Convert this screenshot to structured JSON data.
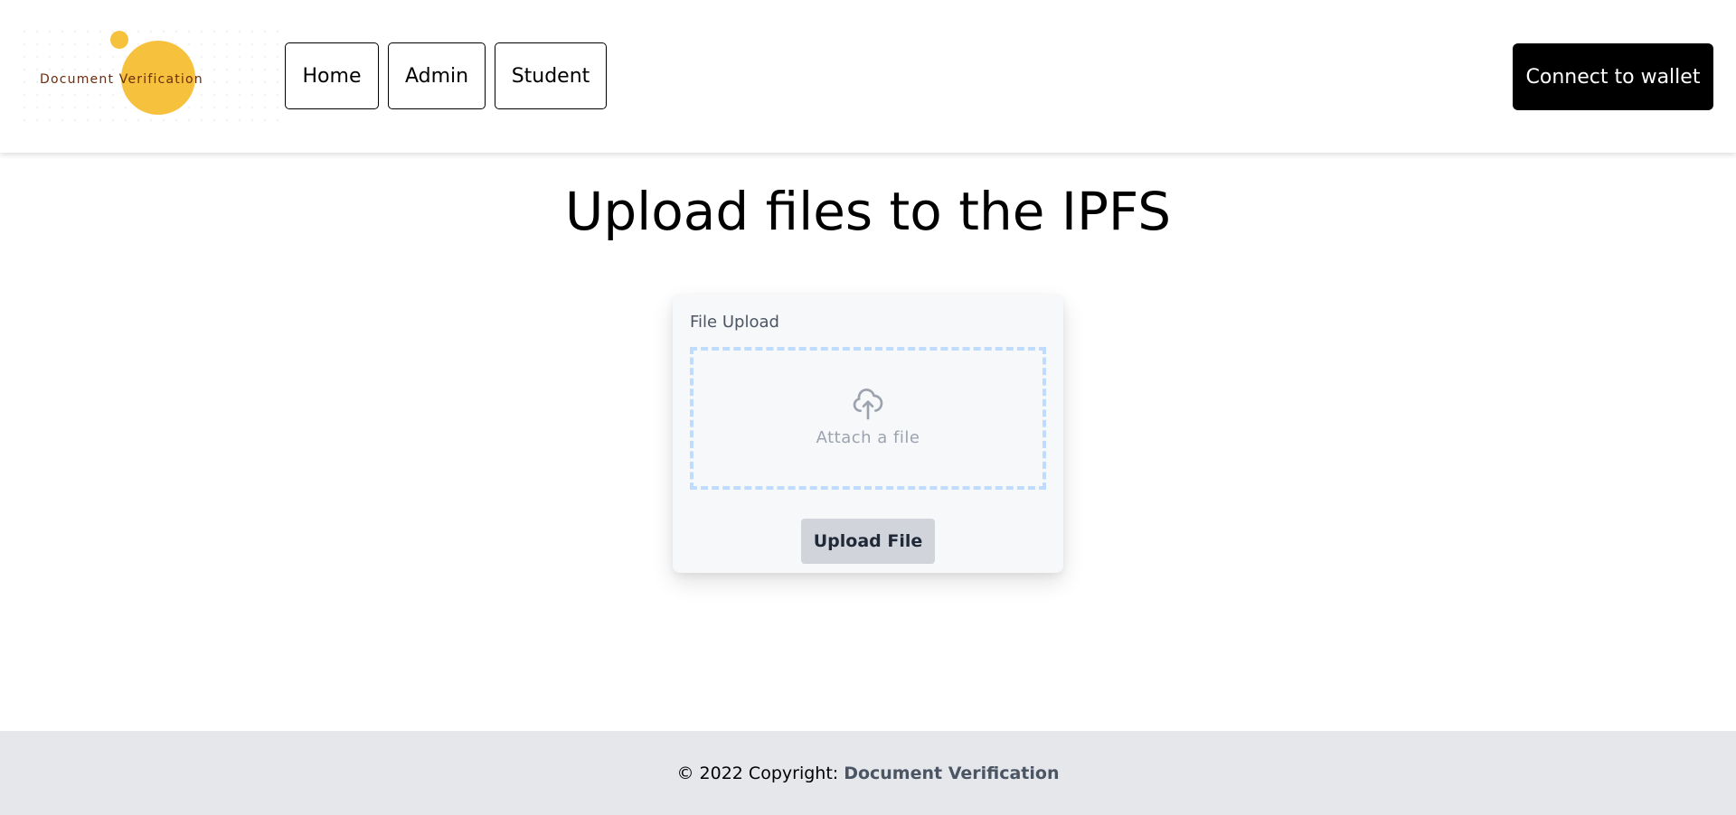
{
  "header": {
    "logo_text": "Document Verification",
    "nav": {
      "home": "Home",
      "admin": "Admin",
      "student": "Student"
    },
    "wallet_button": "Connect to wallet"
  },
  "main": {
    "title": "Upload files to the IPFS",
    "upload_card": {
      "label": "File Upload",
      "attach_text": "Attach a file",
      "upload_button": "Upload File"
    }
  },
  "footer": {
    "copyright_prefix": "© 2022 Copyright:",
    "brand": "Document Verification"
  },
  "colors": {
    "logo_circle": "#f6c23e",
    "wallet_button_bg": "#000000",
    "drop_zone_border": "#bfdbfe",
    "upload_button_bg": "#d1d5db",
    "footer_bg": "#e5e7eb"
  },
  "icons": {
    "upload": "cloud-upload-icon"
  }
}
